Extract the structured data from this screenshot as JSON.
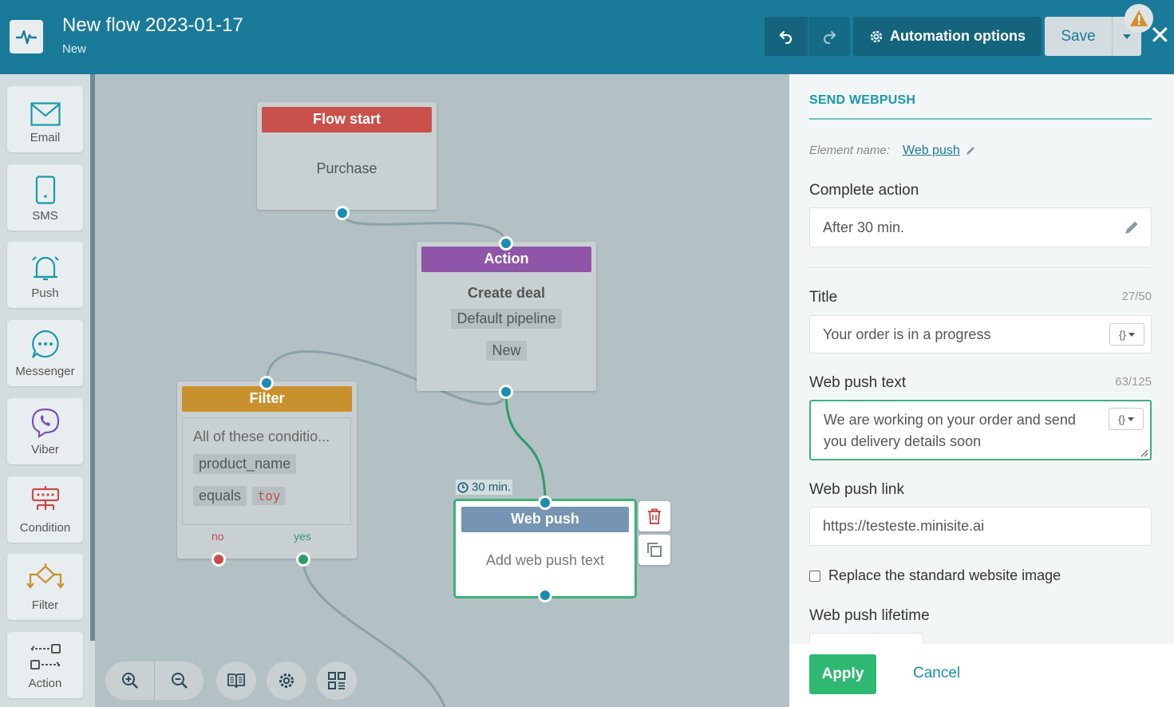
{
  "header": {
    "title": "New flow 2023-01-17",
    "status": "New",
    "automation_options": "Automation options",
    "save": "Save"
  },
  "palette": [
    {
      "label": "Email",
      "icon": "email-icon"
    },
    {
      "label": "SMS",
      "icon": "sms-icon"
    },
    {
      "label": "Push",
      "icon": "push-icon"
    },
    {
      "label": "Messenger",
      "icon": "messenger-icon"
    },
    {
      "label": "Viber",
      "icon": "viber-icon"
    },
    {
      "label": "Condition",
      "icon": "condition-icon"
    },
    {
      "label": "Filter",
      "icon": "filter-icon"
    },
    {
      "label": "Action",
      "icon": "action-icon"
    }
  ],
  "canvas": {
    "flow_start": {
      "title": "Flow start",
      "body": "Purchase"
    },
    "action": {
      "title": "Action",
      "body": "Create deal",
      "chip1": "Default pipeline",
      "chip2": "New"
    },
    "filter": {
      "title": "Filter",
      "body": "All of these conditio...",
      "chip1": "product_name",
      "chip2": "equals",
      "chip3": "toy",
      "no": "no",
      "yes": "yes"
    },
    "web_push": {
      "delay": "30 min.",
      "title": "Web push",
      "body": "Add web push text"
    }
  },
  "panel": {
    "heading": "SEND WEBPUSH",
    "element_name_label": "Element name:",
    "element_name_value": "Web push",
    "complete_action_label": "Complete action",
    "complete_action_value": "After 30 min.",
    "title_label": "Title",
    "title_counter": "27/50",
    "title_value": "Your order is in a progress",
    "text_label": "Web push text",
    "text_counter": "63/125",
    "text_value": "We are working on your order and send you delivery details soon",
    "link_label": "Web push link",
    "link_value": "https://testeste.minisite.ai",
    "replace_image_label": "Replace the standard website image",
    "lifetime_label": "Web push lifetime",
    "apply": "Apply",
    "cancel": "Cancel"
  },
  "colors": {
    "header": "#1a7a99",
    "flow_start": "#c9504b",
    "action": "#8e55a8",
    "filter": "#c9912d",
    "web_push": "#7694b3",
    "apply": "#2eb872",
    "selected_border": "#3fb07b"
  }
}
